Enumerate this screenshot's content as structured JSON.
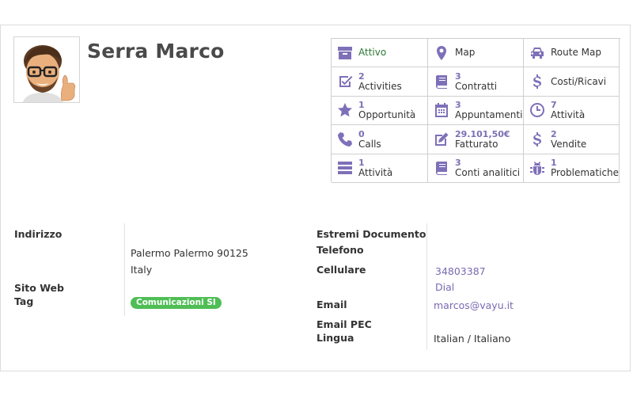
{
  "partner": {
    "name": "Serra Marco"
  },
  "smart_buttons": [
    {
      "icon": "archive-icon",
      "value": "",
      "label": "Attivo",
      "status": "active"
    },
    {
      "icon": "map-pin-icon",
      "value": "",
      "label": "Map"
    },
    {
      "icon": "car-icon",
      "value": "",
      "label": "Route Map"
    },
    {
      "icon": "checkbox-icon",
      "value": "2",
      "label": "Activities"
    },
    {
      "icon": "book-icon",
      "value": "3",
      "label": "Contratti"
    },
    {
      "icon": "dollar-icon",
      "value": "",
      "label": "Costi/Ricavi"
    },
    {
      "icon": "star-icon",
      "value": "1",
      "label": "Opportunità"
    },
    {
      "icon": "calendar-icon",
      "value": "3",
      "label": "Appuntamenti"
    },
    {
      "icon": "clock-icon",
      "value": "7",
      "label": "Attività"
    },
    {
      "icon": "phone-icon",
      "value": "0",
      "label": "Calls"
    },
    {
      "icon": "edit-icon",
      "value": "29.101,50€",
      "label": "Fatturato"
    },
    {
      "icon": "dollar-icon",
      "value": "2",
      "label": "Vendite"
    },
    {
      "icon": "tasks-icon",
      "value": "1",
      "label": "Attività"
    },
    {
      "icon": "book-icon",
      "value": "3",
      "label": "Conti analitici"
    },
    {
      "icon": "bug-icon",
      "value": "1",
      "label": "Problematiche"
    }
  ],
  "left_fields": {
    "address_label": "Indirizzo",
    "address_line1": "Palermo Palermo 90125",
    "address_line2": "Italy",
    "website_label": "Sito Web",
    "tag_label": "Tag",
    "tag_value": "Comunicazioni SI"
  },
  "right_fields": {
    "doc_label": "Estremi Documento",
    "phone_label": "Telefono",
    "mobile_label": "Cellulare",
    "mobile_value": "34803387",
    "dial_label": "Dial",
    "email_label": "Email",
    "email_value": "marcos@vayu.it",
    "pec_label": "Email PEC",
    "lang_label": "Lingua",
    "lang_value": "Italian / Italiano"
  },
  "colors": {
    "icon": "#7e70b8",
    "link": "#7a6ab0",
    "tag_bg": "#4fbe55",
    "active_text": "#2c7a33"
  }
}
